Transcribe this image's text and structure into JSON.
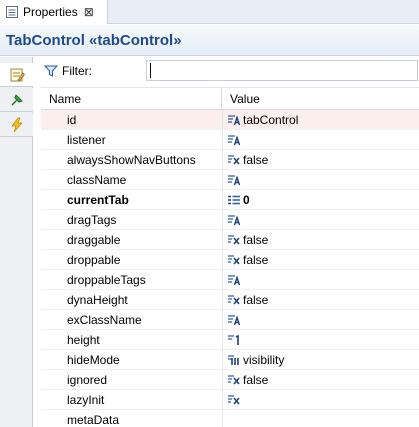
{
  "tab": {
    "label": "Properties",
    "close": "⊠"
  },
  "header": {
    "title": "TabControl «tabControl»"
  },
  "filter": {
    "label": "Filter:",
    "value": "",
    "placeholder": ""
  },
  "table": {
    "columns": [
      "Name",
      "Value"
    ],
    "rows": [
      {
        "name": "id",
        "value": "tabControl",
        "type": "string",
        "bold": false,
        "selected": true
      },
      {
        "name": "listener",
        "value": "",
        "type": "string",
        "bold": false,
        "selected": false
      },
      {
        "name": "alwaysShowNavButtons",
        "value": "false",
        "type": "boolean",
        "bold": false,
        "selected": false
      },
      {
        "name": "className",
        "value": "",
        "type": "string",
        "bold": false,
        "selected": false
      },
      {
        "name": "currentTab",
        "value": "0",
        "type": "list",
        "bold": true,
        "selected": false
      },
      {
        "name": "dragTags",
        "value": "",
        "type": "string",
        "bold": false,
        "selected": false
      },
      {
        "name": "draggable",
        "value": "false",
        "type": "boolean",
        "bold": false,
        "selected": false
      },
      {
        "name": "droppable",
        "value": "false",
        "type": "boolean",
        "bold": false,
        "selected": false
      },
      {
        "name": "droppableTags",
        "value": "",
        "type": "string",
        "bold": false,
        "selected": false
      },
      {
        "name": "dynaHeight",
        "value": "false",
        "type": "boolean",
        "bold": false,
        "selected": false
      },
      {
        "name": "exClassName",
        "value": "",
        "type": "string",
        "bold": false,
        "selected": false
      },
      {
        "name": "height",
        "value": "",
        "type": "number",
        "bold": false,
        "selected": false
      },
      {
        "name": "hideMode",
        "value": "visibility",
        "type": "enum",
        "bold": false,
        "selected": false
      },
      {
        "name": "ignored",
        "value": "false",
        "type": "boolean",
        "bold": false,
        "selected": false
      },
      {
        "name": "lazyInit",
        "value": "",
        "type": "boolean",
        "bold": false,
        "selected": false
      },
      {
        "name": "metaData",
        "value": "",
        "type": "none",
        "bold": false,
        "selected": false
      }
    ]
  },
  "colors": {
    "title": "#1f4b8a",
    "selected_row": "#fdeeee",
    "icon_blue": "#2a5db0"
  }
}
